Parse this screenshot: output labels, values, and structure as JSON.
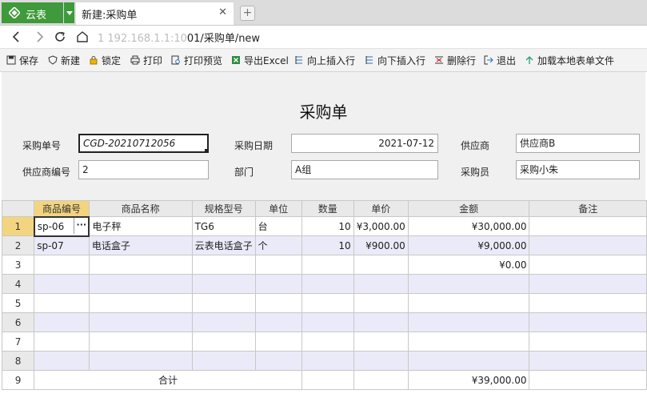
{
  "browser": {
    "app_name": "云表",
    "tab_title": "新建:采购单",
    "tab_close": "✕",
    "url_hidden": "1     192.168.1.1:10",
    "url_visible": "01/采购单/new"
  },
  "toolbar": [
    {
      "label": "保存",
      "icon": "save-icon"
    },
    {
      "label": "新建",
      "icon": "shield-icon"
    },
    {
      "label": "锁定",
      "icon": "lock-icon"
    },
    {
      "label": "打印",
      "icon": "printer-icon"
    },
    {
      "label": "打印预览",
      "icon": "print-preview-icon"
    },
    {
      "label": "导出Excel",
      "icon": "excel-icon"
    },
    {
      "label": "向上插入行",
      "icon": "insert-row-above-icon"
    },
    {
      "label": "向下插入行",
      "icon": "insert-row-below-icon"
    },
    {
      "label": "删除行",
      "icon": "delete-row-icon"
    },
    {
      "label": "退出",
      "icon": "exit-icon"
    },
    {
      "label": "加载本地表单文件",
      "icon": "upload-icon"
    }
  ],
  "form": {
    "title": "采购单",
    "fields": [
      {
        "label": "采购单号",
        "value": "CGD-20210712056"
      },
      {
        "label": "采购日期",
        "value": "2021-07-12"
      },
      {
        "label": "供应商",
        "value": "供应商B"
      },
      {
        "label": "供应商编号",
        "value": "2"
      },
      {
        "label": "部门",
        "value": "A组"
      },
      {
        "label": "采购员",
        "value": "采购小朱"
      }
    ]
  },
  "grid": {
    "columns": [
      "商品编号",
      "商品名称",
      "规格型号",
      "单位",
      "数量",
      "单价",
      "金额",
      "备注"
    ],
    "rows": [
      {
        "num": "1",
        "cells": [
          "sp-06",
          "电子秤",
          "TG6",
          "台",
          "10",
          "¥3,000.00",
          "¥30,000.00",
          ""
        ]
      },
      {
        "num": "2",
        "cells": [
          "sp-07",
          "电话盒子",
          "云表电话盒子",
          "个",
          "10",
          "¥900.00",
          "¥9,000.00",
          ""
        ]
      },
      {
        "num": "3",
        "cells": [
          "",
          "",
          "",
          "",
          "",
          "",
          "¥0.00",
          ""
        ]
      },
      {
        "num": "4",
        "cells": [
          "",
          "",
          "",
          "",
          "",
          "",
          "",
          ""
        ]
      },
      {
        "num": "5",
        "cells": [
          "",
          "",
          "",
          "",
          "",
          "",
          "",
          ""
        ]
      },
      {
        "num": "6",
        "cells": [
          "",
          "",
          "",
          "",
          "",
          "",
          "",
          ""
        ]
      },
      {
        "num": "7",
        "cells": [
          "",
          "",
          "",
          "",
          "",
          "",
          "",
          ""
        ]
      },
      {
        "num": "8",
        "cells": [
          "",
          "",
          "",
          "",
          "",
          "",
          "",
          ""
        ]
      }
    ],
    "total_row": {
      "num": "9",
      "label": "合计",
      "amount": "¥39,000.00"
    },
    "cell_button": "···"
  }
}
